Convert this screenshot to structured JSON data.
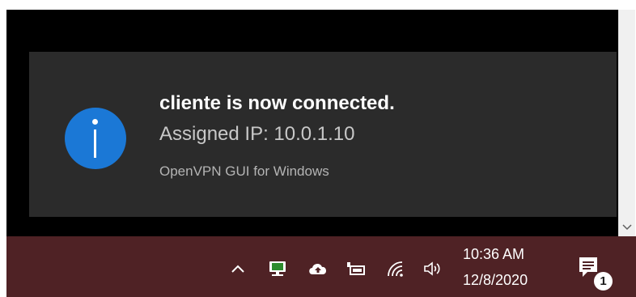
{
  "notification": {
    "title": "cliente is now connected.",
    "body": "Assigned IP: 10.0.1.10",
    "source": "OpenVPN GUI for Windows",
    "icon": "info-icon"
  },
  "taskbar": {
    "tray_icons": [
      "show-hidden-icons-chevron",
      "openvpn-connected-icon",
      "onedrive-cloud-icon",
      "battery-power-icon",
      "wifi-icon",
      "volume-icon"
    ],
    "time": "10:36 AM",
    "date": "12/8/2020",
    "action_center_badge": "1"
  },
  "colors": {
    "toast_background": "#2b2b2b",
    "info_blue": "#1b78d6",
    "taskbar_background": "#4f2225"
  }
}
